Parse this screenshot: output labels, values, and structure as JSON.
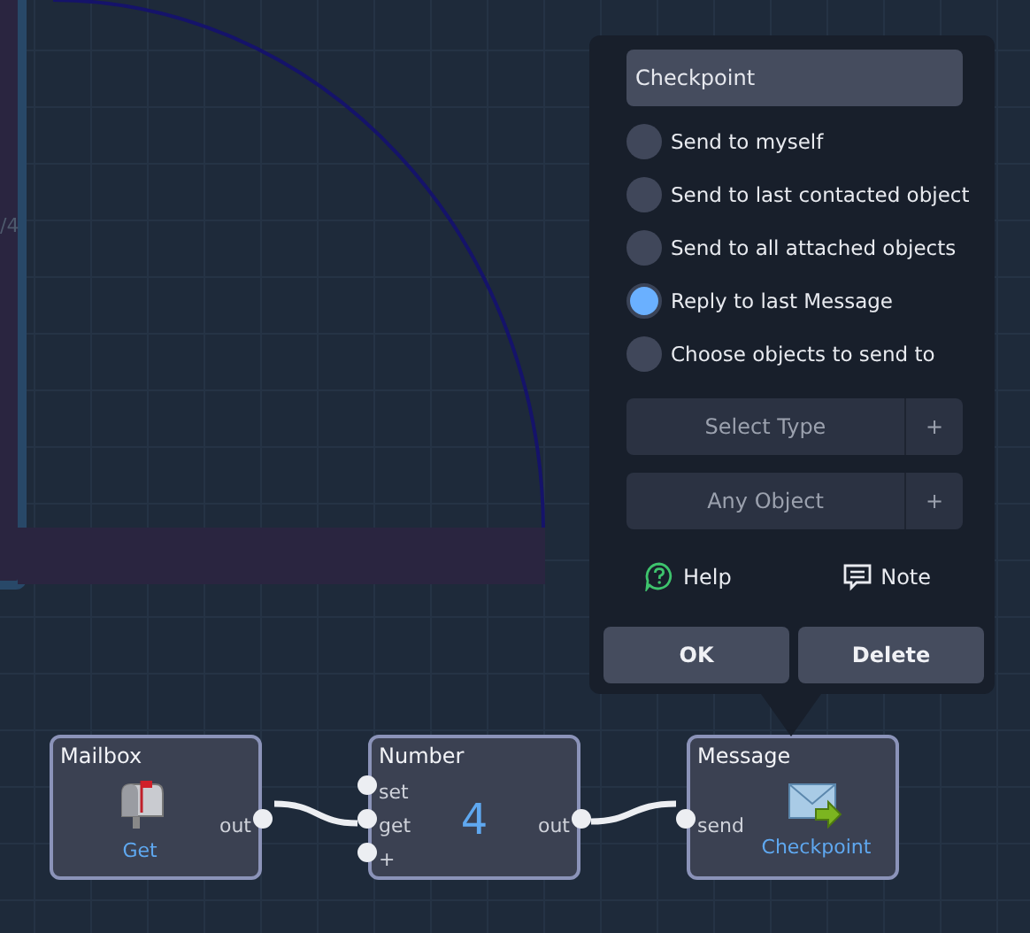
{
  "canvas": {
    "panel_label": "/4"
  },
  "popup": {
    "name_field": {
      "value": "Checkpoint"
    },
    "options": [
      {
        "label": "Send to myself",
        "selected": false
      },
      {
        "label": "Send to last contacted object",
        "selected": false
      },
      {
        "label": "Send to all attached objects",
        "selected": false
      },
      {
        "label": "Reply to last Message",
        "selected": true
      },
      {
        "label": "Choose objects to send to",
        "selected": false
      }
    ],
    "dropdowns": [
      {
        "label": "Select Type",
        "add": "+"
      },
      {
        "label": "Any Object",
        "add": "+"
      }
    ],
    "links": [
      {
        "kind": "help",
        "label": "Help"
      },
      {
        "kind": "note",
        "label": "Note"
      }
    ],
    "buttons": [
      "OK",
      "Delete"
    ]
  },
  "nodes": [
    {
      "kind": "mailbox",
      "title": "Mailbox",
      "caption": "Get",
      "outputs": [
        "out"
      ]
    },
    {
      "kind": "number",
      "title": "Number",
      "value": "4",
      "inputs": [
        "set",
        "get",
        "+"
      ],
      "outputs": [
        "out"
      ]
    },
    {
      "kind": "message",
      "title": "Message",
      "caption": "Checkpoint",
      "inputs": [
        "send"
      ]
    }
  ]
}
